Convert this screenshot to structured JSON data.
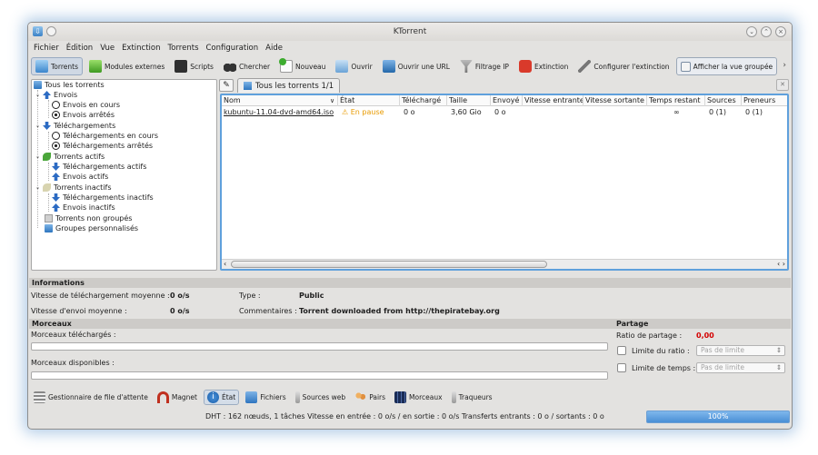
{
  "window": {
    "title": "KTorrent"
  },
  "menu": [
    "Fichier",
    "Édition",
    "Vue",
    "Extinction",
    "Torrents",
    "Configuration",
    "Aide"
  ],
  "toolbar": {
    "torrents": "Torrents",
    "modules": "Modules externes",
    "scripts": "Scripts",
    "chercher": "Chercher",
    "nouveau": "Nouveau",
    "ouvrir": "Ouvrir",
    "ouvrir_url": "Ouvrir une URL",
    "filtrage": "Filtrage IP",
    "extinction": "Extinction",
    "config_ext": "Configurer l'extinction",
    "vue_groupee": "Afficher la vue groupée"
  },
  "tree": {
    "all": "Tous les torrents",
    "envois": "Envois",
    "envois_en_cours": "Envois en cours",
    "envois_arretes": "Envois arrêtés",
    "telechargements": "Téléchargements",
    "tel_en_cours": "Téléchargements en cours",
    "tel_arretes": "Téléchargements arrêtés",
    "actifs": "Torrents actifs",
    "tel_actifs": "Téléchargements actifs",
    "envois_actifs": "Envois actifs",
    "inactifs": "Torrents inactifs",
    "tel_inactifs": "Téléchargements inactifs",
    "envois_inactifs": "Envois inactifs",
    "non_groupes": "Torrents non groupés",
    "groupes_perso": "Groupes personnalisés"
  },
  "tab": {
    "label": "Tous les torrents 1/1"
  },
  "table": {
    "columns": [
      "Nom",
      "État",
      "Téléchargé",
      "Taille",
      "Envoyé",
      "Vitesse entrante",
      "Vitesse sortante",
      "Temps restant",
      "Sources",
      "Preneurs"
    ],
    "row": {
      "nom": "kubuntu-11.04-dvd-amd64.iso",
      "etat": "En pause",
      "telecharge": "0 o",
      "taille": "3,60 Gio",
      "envoye": "0 o",
      "vitesse_in": "",
      "vitesse_out": "",
      "temps": "∞",
      "sources": "0 (1)",
      "preneurs": "0 (1)"
    }
  },
  "info": {
    "header": "Informations",
    "dl_avg_label": "Vitesse de téléchargement moyenne :",
    "dl_avg": "0 o/s",
    "up_avg_label": "Vitesse d'envoi moyenne :",
    "up_avg": "0 o/s",
    "type_label": "Type :",
    "type": "Public",
    "comment_label": "Commentaires :",
    "comment": "Torrent downloaded from http://thepiratebay.org"
  },
  "morceaux": {
    "header": "Morceaux",
    "telecharges": "Morceaux téléchargés :",
    "disponibles": "Morceaux disponibles :"
  },
  "partage": {
    "header": "Partage",
    "ratio_label": "Ratio de partage :",
    "ratio": "0,00",
    "limite_ratio": "Limite du ratio :",
    "limite_temps": "Limite de temps :",
    "pas_de_limite": "Pas de limite"
  },
  "bottom_tabs": [
    "Gestionnaire de file d'attente",
    "Magnet",
    "État",
    "Fichiers",
    "Sources web",
    "Pairs",
    "Morceaux",
    "Traqueurs"
  ],
  "status": {
    "text": "DHT : 162 nœuds, 1 tâches   Vitesse en entrée : 0 o/s / en sortie : 0 o/s   Transferts entrants : 0 o / sortants : 0 o",
    "progress": "100%",
    "progress_fraction": 1.0
  },
  "colors": {
    "accent": "#5fa0dc",
    "paused": "#e89a00",
    "ratio": "#d40000"
  }
}
